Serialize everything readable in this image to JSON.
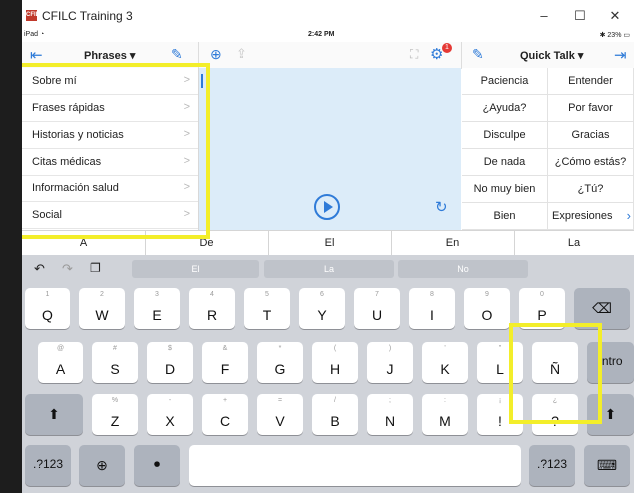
{
  "window": {
    "app_icon_text": "CFILC",
    "title": "CFILC Training 3",
    "minimize": "–",
    "maximize": "☐",
    "close": "✕"
  },
  "status": {
    "device": "iPad",
    "time": "2:42 PM",
    "battery": "23%"
  },
  "left_header": {
    "title": "Phrases ▾"
  },
  "right_header": {
    "title": "Quick Talk ▾"
  },
  "badge_count": "1",
  "phrases": [
    {
      "label": "Sobre mí"
    },
    {
      "label": "Frases rápidas"
    },
    {
      "label": "Historias y noticias"
    },
    {
      "label": "Citas médicas"
    },
    {
      "label": "Información salud"
    },
    {
      "label": "Social"
    }
  ],
  "quick_talk": [
    "Paciencia",
    "Entender",
    "¿Ayuda?",
    "Por favor",
    "Disculpe",
    "Gracias",
    "De nada",
    "¿Cómo estás?",
    "No muy bien",
    "¿Tú?",
    "Bien",
    "Expresiones"
  ],
  "predictions": [
    "A",
    "De",
    "El",
    "En",
    "La"
  ],
  "suggestions": [
    "El",
    "La",
    "No"
  ],
  "keyboard": {
    "row1": [
      {
        "sub": "1",
        "main": "Q"
      },
      {
        "sub": "2",
        "main": "W"
      },
      {
        "sub": "3",
        "main": "E"
      },
      {
        "sub": "4",
        "main": "R"
      },
      {
        "sub": "5",
        "main": "T"
      },
      {
        "sub": "6",
        "main": "Y"
      },
      {
        "sub": "7",
        "main": "U"
      },
      {
        "sub": "8",
        "main": "I"
      },
      {
        "sub": "9",
        "main": "O"
      },
      {
        "sub": "0",
        "main": "P"
      }
    ],
    "row2": [
      {
        "sub": "@",
        "main": "A"
      },
      {
        "sub": "#",
        "main": "S"
      },
      {
        "sub": "$",
        "main": "D"
      },
      {
        "sub": "&",
        "main": "F"
      },
      {
        "sub": "*",
        "main": "G"
      },
      {
        "sub": "(",
        "main": "H"
      },
      {
        "sub": ")",
        "main": "J"
      },
      {
        "sub": "'",
        "main": "K"
      },
      {
        "sub": "\"",
        "main": "L"
      },
      {
        "sub": "",
        "main": "Ñ"
      }
    ],
    "row3": [
      {
        "sub": "%",
        "main": "Z"
      },
      {
        "sub": "-",
        "main": "X"
      },
      {
        "sub": "+",
        "main": "C"
      },
      {
        "sub": "=",
        "main": "V"
      },
      {
        "sub": "/",
        "main": "B"
      },
      {
        "sub": ";",
        "main": "N"
      },
      {
        "sub": ":",
        "main": "M"
      },
      {
        "sub": "¡",
        "main": "!"
      },
      {
        "sub": "¿",
        "main": "?"
      }
    ],
    "delete": "⌫",
    "return": "Intro",
    "shift": "⬆",
    "num_left": ".?123",
    "num_right": ".?123",
    "globe": "🌐",
    "mic": "🎙",
    "hide_kb": "⌨"
  },
  "colors": {
    "accent": "#2f7bd8",
    "highlight": "#f3ee2a",
    "center_bg": "#dcecf9",
    "keyboard_bg": "#d0d3d9"
  }
}
